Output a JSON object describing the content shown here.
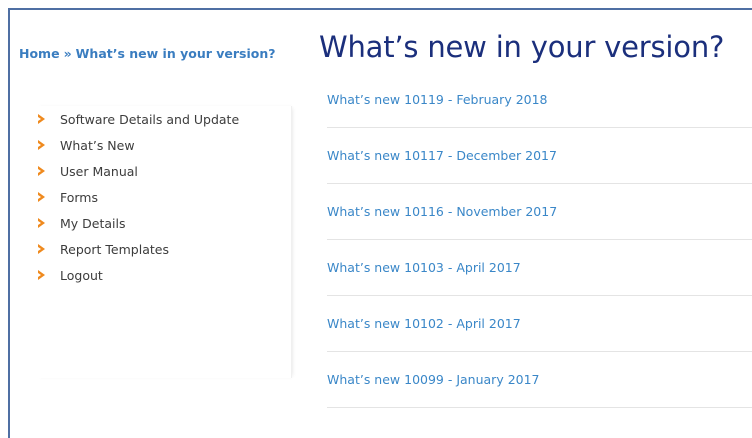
{
  "breadcrumb": {
    "home": "Home",
    "separator": "»",
    "current": "What’s new in your version?"
  },
  "page_title": "What’s new in your version?",
  "sidebar": {
    "items": [
      {
        "label": "Software Details and Update",
        "icon": "orange-arrow-icon"
      },
      {
        "label": "What’s New",
        "icon": "orange-arrow-icon"
      },
      {
        "label": "User Manual",
        "icon": "orange-arrow-icon"
      },
      {
        "label": "Forms",
        "icon": "orange-arrow-icon"
      },
      {
        "label": "My Details",
        "icon": "orange-arrow-icon"
      },
      {
        "label": "Report Templates",
        "icon": "orange-arrow-icon"
      },
      {
        "label": "Logout",
        "icon": "orange-arrow-icon"
      }
    ]
  },
  "news": {
    "items": [
      {
        "label": "What’s new 10119 - February 2018"
      },
      {
        "label": "What’s new 10117 - December 2017"
      },
      {
        "label": "What’s new 10116 - November 2017"
      },
      {
        "label": "What’s new 10103 - April 2017"
      },
      {
        "label": "What’s new 10102 - April 2017"
      },
      {
        "label": "What’s new 10099 - January 2017"
      }
    ]
  },
  "colors": {
    "title": "#1b2f7c",
    "link": "#3a87c8",
    "breadcrumb": "#3a7dc0",
    "bullet": "#ef8a1e",
    "frame": "#4f6fa3"
  }
}
